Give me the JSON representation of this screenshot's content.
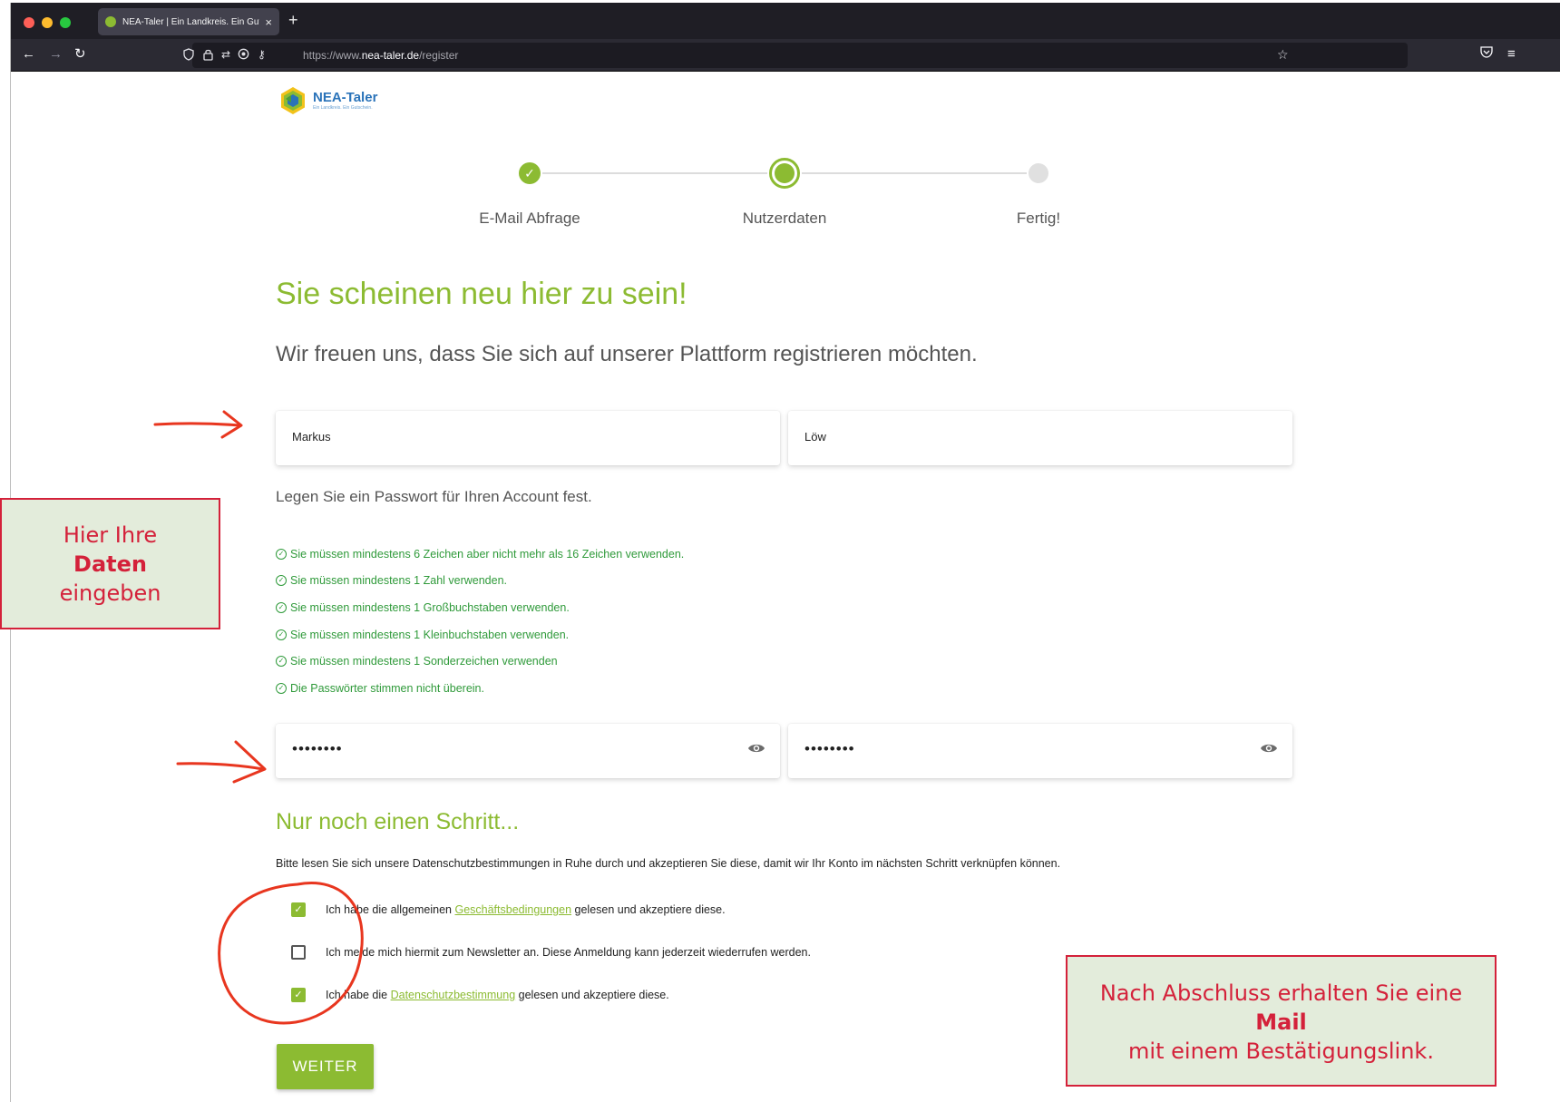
{
  "browser": {
    "tab_title": "NEA-Taler | Ein Landkreis. Ein Gutschein",
    "tab_close": "×",
    "new_tab": "+",
    "url_host": "https://www.",
    "url_domain": "nea-taler.de",
    "url_path": "/register",
    "icons": [
      "back-icon",
      "forward-icon",
      "reload-icon",
      "shield-icon",
      "lock-icon",
      "permissions-icon",
      "location-icon",
      "key-icon",
      "star-icon",
      "pocket-icon",
      "menu-icon"
    ]
  },
  "logo": {
    "name": "NEA-Taler",
    "tagline": "Ein Landkreis. Ein Gutschein."
  },
  "stepper": {
    "steps": [
      {
        "label": "E-Mail Abfrage",
        "state": "done"
      },
      {
        "label": "Nutzerdaten",
        "state": "active"
      },
      {
        "label": "Fertig!",
        "state": "todo"
      }
    ],
    "check": "✓"
  },
  "form": {
    "heading": "Sie scheinen neu hier zu sein!",
    "subheading": "Wir freuen uns, dass Sie sich auf unserer Plattform registrieren möchten.",
    "first_name": "Markus",
    "last_name": "Löw",
    "password_intro": "Legen Sie ein Passwort für Ihren Account fest.",
    "rules": [
      "Sie müssen mindestens 6 Zeichen aber nicht mehr als 16 Zeichen verwenden.",
      "Sie müssen mindestens 1 Zahl verwenden.",
      "Sie müssen mindestens 1 Großbuchstaben verwenden.",
      "Sie müssen mindestens 1 Kleinbuchstaben verwenden.",
      "Sie müssen mindestens 1 Sonderzeichen verwenden",
      "Die Passwörter stimmen nicht überein."
    ],
    "rule_icon": "✓",
    "password": "••••••••",
    "password_repeat": "••••••••",
    "step_heading": "Nur noch einen Schritt...",
    "privacy_text": "Bitte lesen Sie sich unsere Datenschutzbestimmungen in Ruhe durch und akzeptieren Sie diese, damit wir Ihr Konto im nächsten Schritt verknüpfen können.",
    "checkboxes": [
      {
        "checked": true,
        "before": "Ich habe die allgemeinen ",
        "link": "Geschäftsbedingungen",
        "after": " gelesen und akzeptiere diese."
      },
      {
        "checked": false,
        "before": "Ich melde mich hiermit zum Newsletter an. Diese Anmeldung kann jederzeit wiederrufen werden.",
        "link": "",
        "after": ""
      },
      {
        "checked": true,
        "before": "Ich habe die ",
        "link": "Datenschutzbestimmung",
        "after": " gelesen und akzeptiere diese."
      }
    ],
    "submit_label": "WEITER"
  },
  "annotations": {
    "left": {
      "line1": "Hier Ihre",
      "bold": "Daten",
      "line3": "eingeben"
    },
    "right": {
      "line1": "Nach Abschluss erhalten Sie eine",
      "bold": "Mail",
      "line3": "mit einem Bestätigungslink."
    }
  },
  "colors": {
    "brand_green": "#8cbb32",
    "rule_green": "#2f9a3a",
    "annotation_red": "#d4213a",
    "annotation_bg": "#e3ecdb",
    "logo_blue": "#2a73b9"
  }
}
